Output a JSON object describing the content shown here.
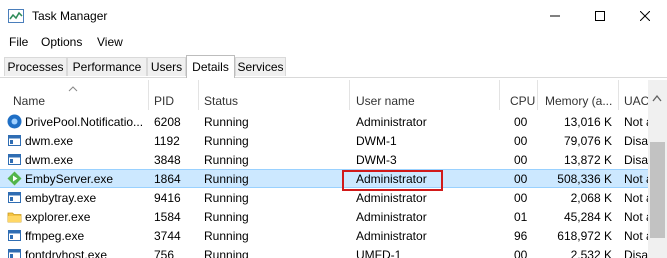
{
  "window": {
    "title": "Task Manager"
  },
  "menu": {
    "items": [
      "File",
      "Options",
      "View"
    ]
  },
  "tabs": [
    "Processes",
    "Performance",
    "Users",
    "Details",
    "Services"
  ],
  "active_tab": "Details",
  "columns": {
    "name": "Name",
    "pid": "PID",
    "status": "Status",
    "user": "User name",
    "cpu": "CPU",
    "memory": "Memory (a...",
    "uac": "UAC"
  },
  "rows": [
    {
      "name": "DrivePool.Notificatio...",
      "pid": "6208",
      "status": "Running",
      "user": "Administrator",
      "cpu": "00",
      "memory": "13,016 K",
      "uac": "Not a",
      "icon": "drivepool-icon"
    },
    {
      "name": "dwm.exe",
      "pid": "1192",
      "status": "Running",
      "user": "DWM-1",
      "cpu": "00",
      "memory": "79,076 K",
      "uac": "Disab",
      "icon": "app-window-icon"
    },
    {
      "name": "dwm.exe",
      "pid": "3848",
      "status": "Running",
      "user": "DWM-3",
      "cpu": "00",
      "memory": "13,872 K",
      "uac": "Disab",
      "icon": "app-window-icon"
    },
    {
      "name": "EmbyServer.exe",
      "pid": "1864",
      "status": "Running",
      "user": "Administrator",
      "cpu": "00",
      "memory": "508,336 K",
      "uac": "Not a",
      "icon": "emby-icon",
      "selected": true
    },
    {
      "name": "embytray.exe",
      "pid": "9416",
      "status": "Running",
      "user": "Administrator",
      "cpu": "00",
      "memory": "2,068 K",
      "uac": "Not a",
      "icon": "app-window-icon"
    },
    {
      "name": "explorer.exe",
      "pid": "1584",
      "status": "Running",
      "user": "Administrator",
      "cpu": "01",
      "memory": "45,284 K",
      "uac": "Not a",
      "icon": "folder-icon"
    },
    {
      "name": "ffmpeg.exe",
      "pid": "3744",
      "status": "Running",
      "user": "Administrator",
      "cpu": "96",
      "memory": "618,972 K",
      "uac": "Not a",
      "icon": "app-window-icon"
    },
    {
      "name": "fontdrvhost.exe",
      "pid": "756",
      "status": "Running",
      "user": "UMFD-1",
      "cpu": "00",
      "memory": "2,532 K",
      "uac": "Disab",
      "icon": "app-window-icon"
    }
  ],
  "colors": {
    "selected_row_bg": "#cce8ff",
    "selected_row_border": "#99d1ff",
    "highlight_box": "#d11a1a"
  }
}
